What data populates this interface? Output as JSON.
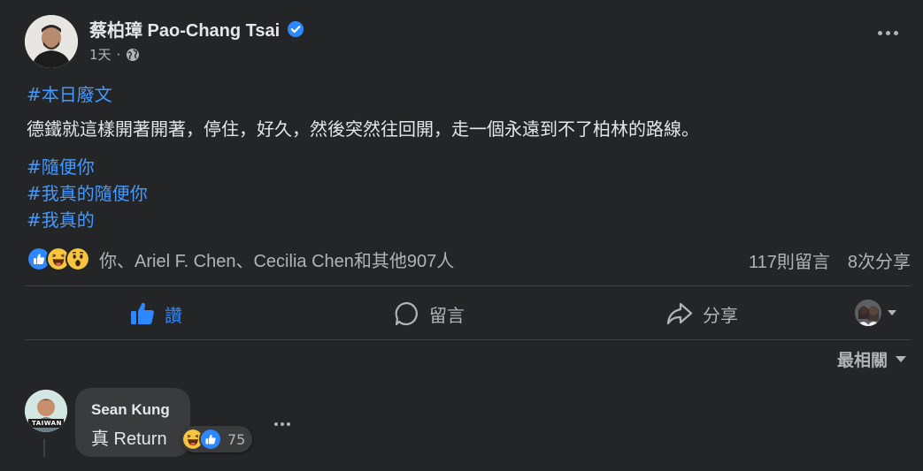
{
  "post": {
    "author": "蔡柏璋 Pao-Chang Tsai",
    "time": "1天",
    "privacy_icon": "globe-icon",
    "tag_top": "#本日廢文",
    "text": "德鐵就這樣開著開著，停住，好久，然後突然往回開，走一個永遠到不了柏林的路線。",
    "tags": [
      "#隨便你",
      "#我真的隨便你",
      "#我真的"
    ]
  },
  "reactions": {
    "icons": [
      "like-icon",
      "haha-icon",
      "wow-icon"
    ],
    "names": "你、Ariel F. Chen、Cecilia Chen和其他907人",
    "comments": "117則留言",
    "shares": "8次分享"
  },
  "actions": {
    "like": "讚",
    "comment": "留言",
    "share": "分享"
  },
  "sort": {
    "label": "最相關"
  },
  "comment": {
    "name": "Sean Kung",
    "text": "真 Return",
    "reaction_count": "75",
    "avatar_text": "TAIWAN"
  },
  "colors": {
    "background": "#242526",
    "accent": "#2d88ff",
    "hashtag": "#4599ff",
    "secondary_text": "#b0b3b8"
  }
}
